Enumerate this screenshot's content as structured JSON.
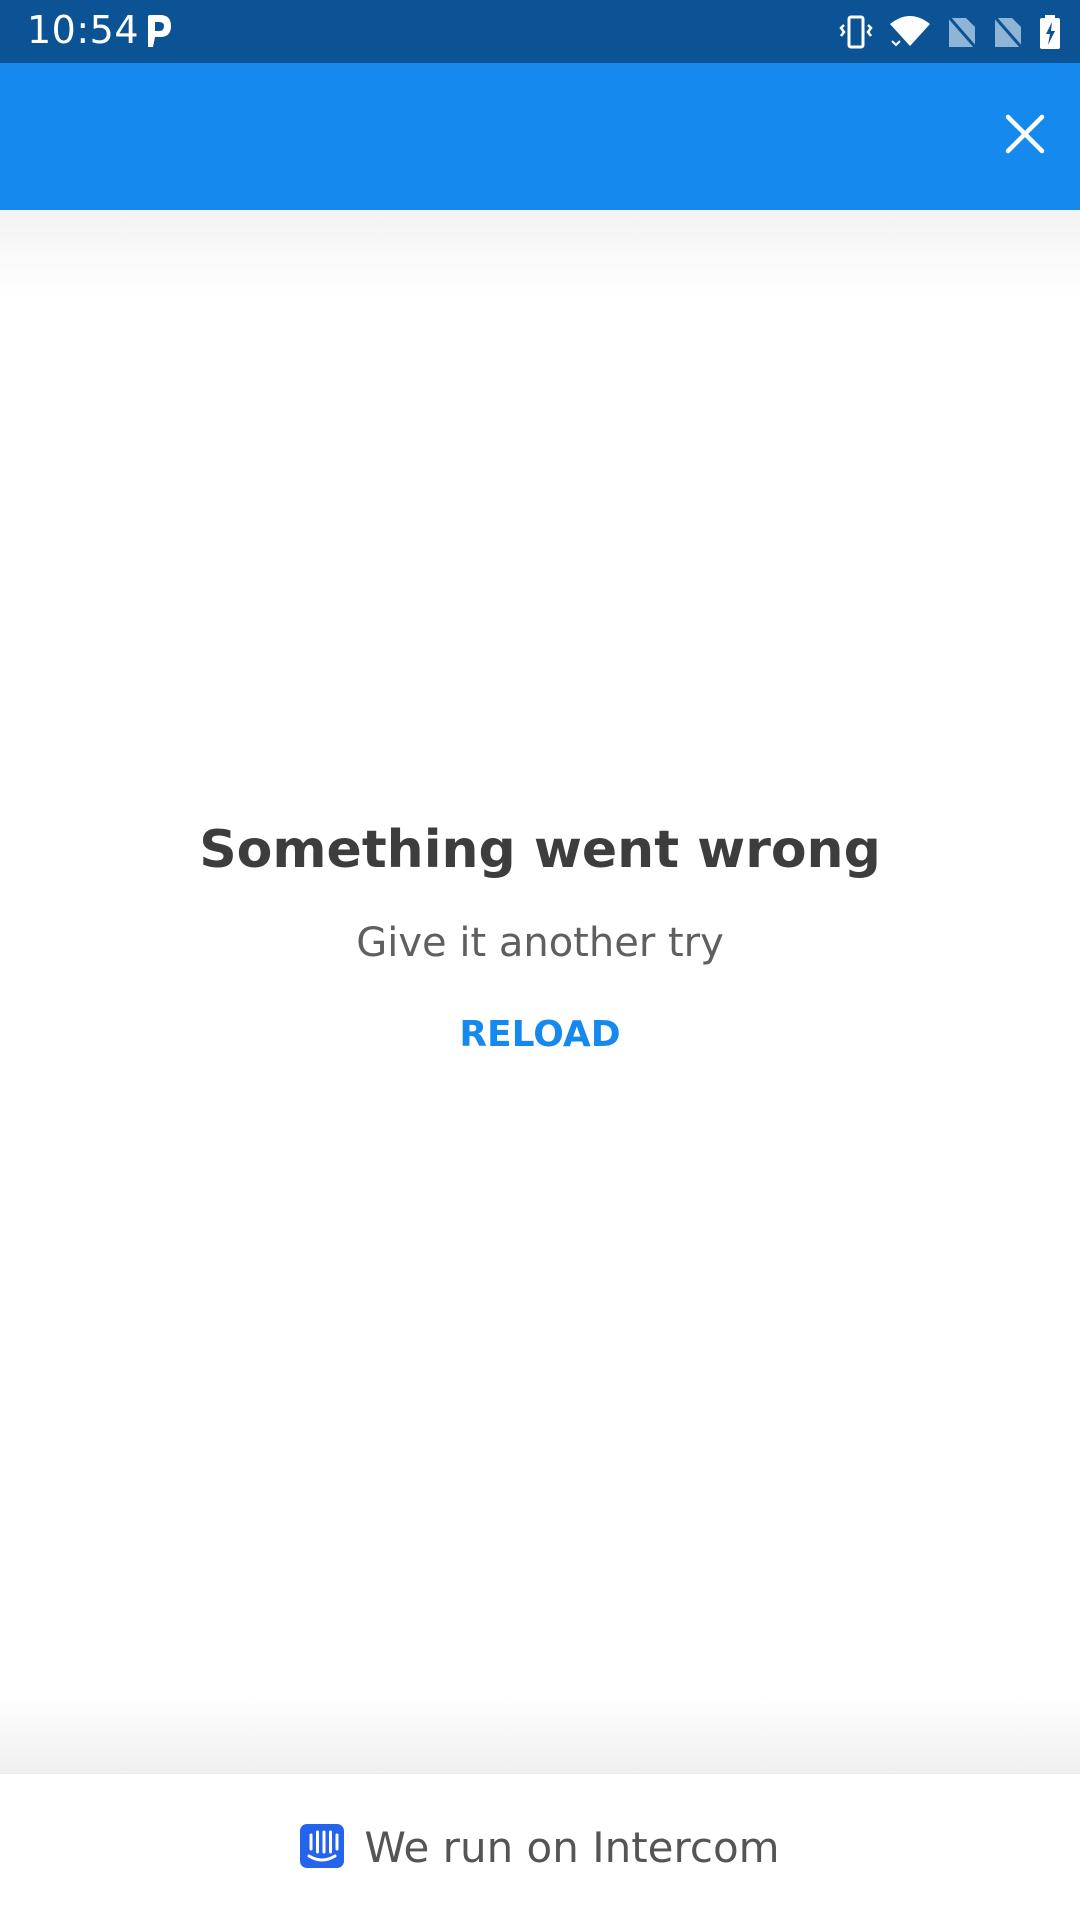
{
  "status_bar": {
    "time": "10:54",
    "icons": [
      "parking-app-icon",
      "vibrate-icon",
      "wifi-icon",
      "no-sim-icon",
      "no-sim-icon",
      "battery-charging-icon"
    ]
  },
  "app_bar": {
    "close_icon": "close-icon",
    "background_color": "#1589ee"
  },
  "error": {
    "title": "Something went wrong",
    "subtitle": "Give it another try",
    "reload_label": "RELOAD"
  },
  "footer": {
    "icon": "intercom-logo-icon",
    "text": "We run on Intercom"
  },
  "colors": {
    "status_bar": "#0b5394",
    "accent": "#1589ee",
    "title_text": "#3d3d3d",
    "body_text": "#5f5f5f"
  }
}
